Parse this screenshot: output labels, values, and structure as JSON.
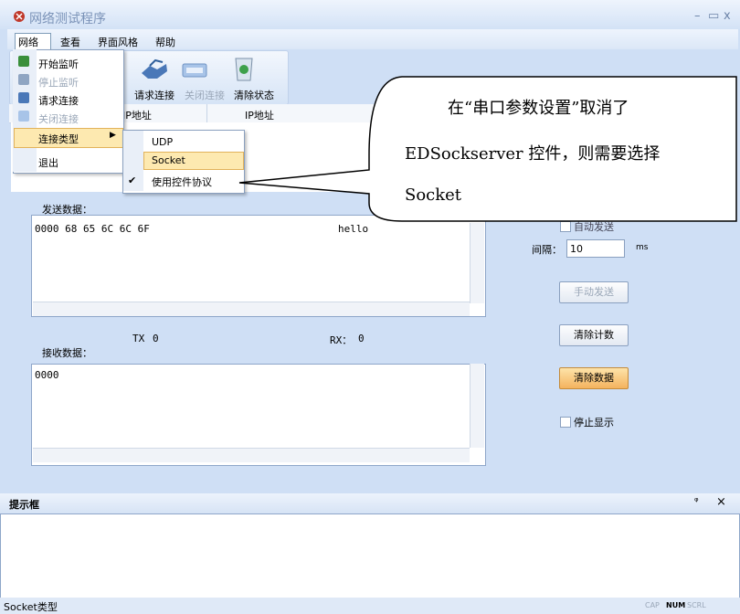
{
  "window": {
    "title": "网络测试程序",
    "minimize": "–",
    "maximize": "▭",
    "close": "x"
  },
  "menu": {
    "items": [
      "网络",
      "查看",
      "界面风格",
      "帮助"
    ]
  },
  "network_menu": {
    "items": [
      "开始监听",
      "停止监听",
      "请求连接",
      "关闭连接",
      "连接类型",
      "退出"
    ]
  },
  "connection_type_menu": {
    "items": [
      "UDP",
      "Socket",
      "使用控件协议"
    ]
  },
  "toolbar": {
    "labels": [
      "请求连接",
      "关闭连接",
      "清除状态"
    ]
  },
  "grid": {
    "columns": [
      "IP地址",
      "IP地址"
    ]
  },
  "send": {
    "label": "发送数据：",
    "hex": "0000 68 65 6C 6C 6F",
    "ascii": "hello"
  },
  "counters": {
    "tx_label": "TX",
    "tx_value": "0",
    "rx_label": "RX：",
    "rx_value": "0"
  },
  "receive": {
    "label": "接收数据：",
    "hex": "0000"
  },
  "controls": {
    "auto_send": "自动发送",
    "interval_label": "间隔：",
    "interval_value": "10",
    "interval_unit": "ms",
    "manual_send": "手动发送",
    "clear_count": "清除计数",
    "clear_data": "清除数据",
    "stop_display": "停止显示"
  },
  "callout": {
    "line1": "在“串口参数设置”取消了",
    "line2": "EDSockserver 控件，则需要选择",
    "line3": "Socket"
  },
  "hint": {
    "title": "提示框",
    "pin": "ᵠ",
    "close": "×"
  },
  "status": {
    "text": "Socket类型",
    "cap": "CAP",
    "num": "NUM",
    "scrl": "SCRL"
  }
}
